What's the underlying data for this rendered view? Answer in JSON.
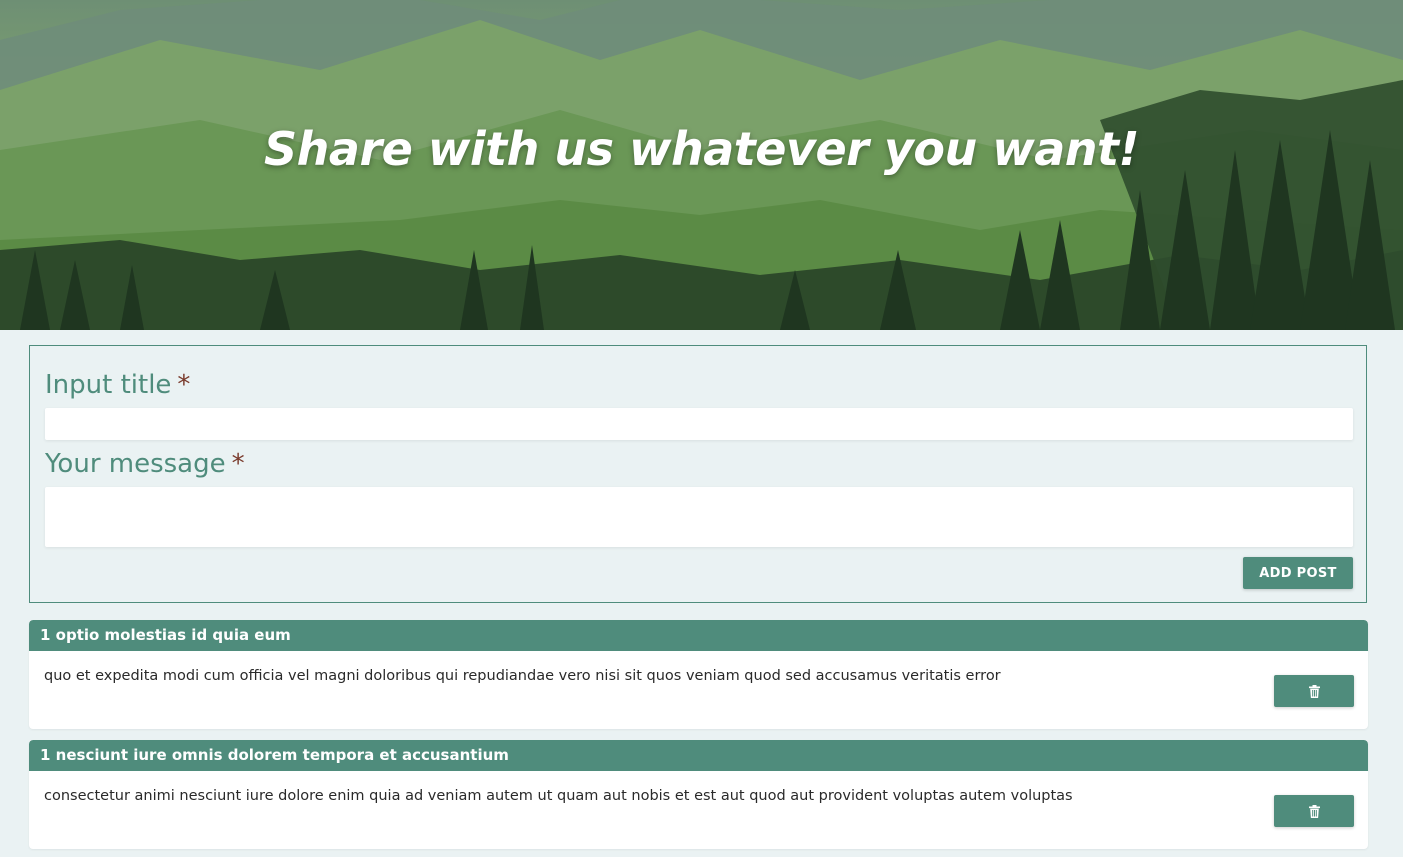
{
  "hero": {
    "title": "Share with us whatever you want!"
  },
  "form": {
    "title_label": "Input title",
    "message_label": "Your message",
    "required_mark": "*",
    "title_value": "",
    "message_value": "",
    "add_button_label": "ADD POST"
  },
  "posts": [
    {
      "title": "1 optio molestias id quia eum",
      "body": "quo et expedita modi cum officia vel magni doloribus qui repudiandae vero nisi sit quos veniam quod sed accusamus veritatis error",
      "delete_icon": "trash-icon"
    },
    {
      "title": "1 nesciunt iure omnis dolorem tempora et accusantium",
      "body": "consectetur animi nesciunt iure dolore enim quia ad veniam autem ut quam aut nobis et est aut quod aut provident voluptas autem voluptas",
      "delete_icon": "trash-icon"
    }
  ],
  "colors": {
    "accent": "#4f8c7c",
    "page_background": "#eaf2f3",
    "required_mark": "#7a3b2c"
  }
}
